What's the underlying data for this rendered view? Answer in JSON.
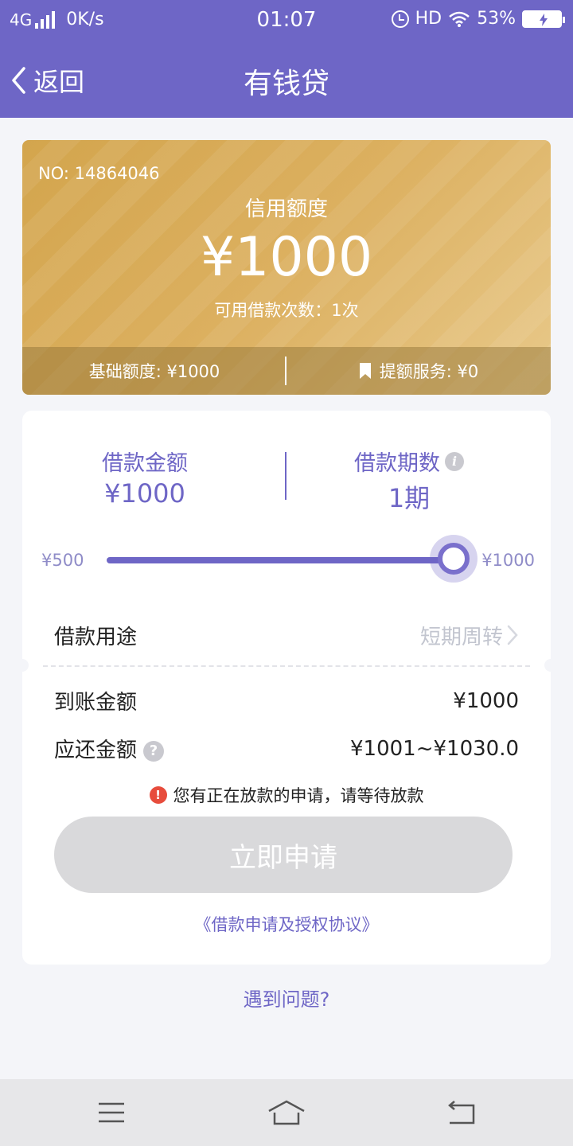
{
  "status_bar": {
    "network": "4G",
    "speed": "0K/s",
    "time": "01:07",
    "hd": "HD",
    "battery": "53%"
  },
  "nav": {
    "back_label": "返回",
    "title": "有钱贷"
  },
  "credit_card": {
    "number": "NO: 14864046",
    "label": "信用额度",
    "amount": "¥1000",
    "borrow_times": "可用借款次数：1次",
    "base_limit": "基础额度: ¥1000",
    "raise_service": "提额服务: ¥0"
  },
  "loan": {
    "amount_label": "借款金额",
    "amount_value": "¥1000",
    "term_label": "借款期数",
    "term_value": "1期",
    "slider": {
      "min_label": "¥500",
      "max_label": "¥1000",
      "value": 1000
    },
    "purpose_label": "借款用途",
    "purpose_value": "短期周转",
    "arrive_label": "到账金额",
    "arrive_value": "¥1000",
    "repay_label": "应还金额",
    "repay_value": "¥1001~¥1030.0",
    "warning": "您有正在放款的申请，请等待放款",
    "apply_button": "立即申请",
    "agreement": "《借款申请及授权协议》"
  },
  "help_link": "遇到问题?",
  "colors": {
    "primary": "#6e66c6",
    "gold": "#d9ad5a",
    "warning": "#e74c3c",
    "disabled_button": "#d9d9db"
  }
}
